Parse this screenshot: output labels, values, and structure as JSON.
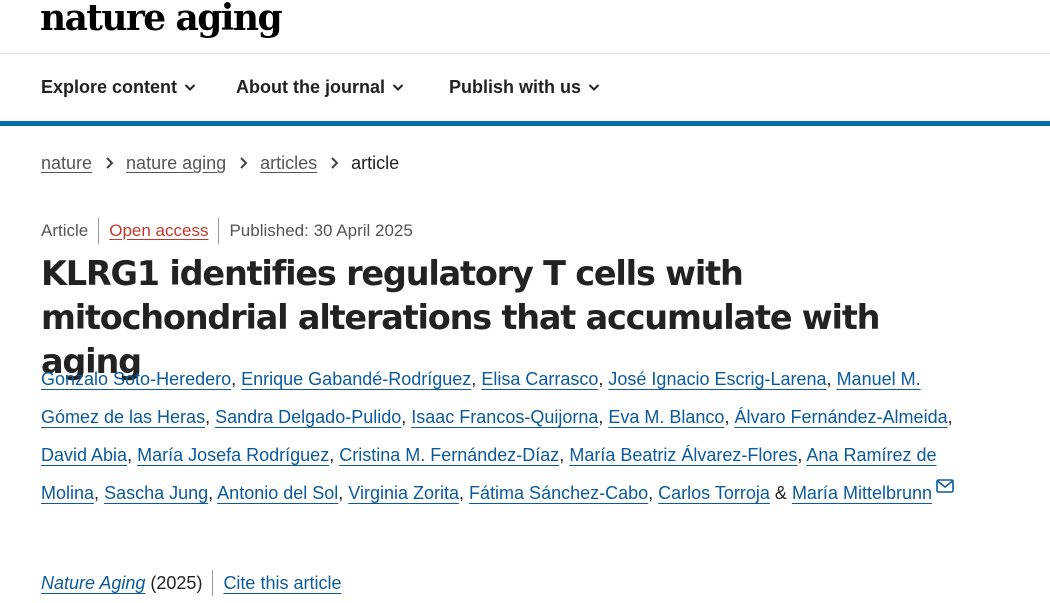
{
  "header": {
    "logo_text": "nature aging"
  },
  "nav": {
    "items": [
      {
        "label": "Explore content"
      },
      {
        "label": "About the journal"
      },
      {
        "label": "Publish with us"
      }
    ]
  },
  "colors": {
    "accent_bar": "#0070a8",
    "link": "#0a5a9c",
    "open_access": "#c0392b"
  },
  "breadcrumb": {
    "items": [
      "nature",
      "nature aging",
      "articles"
    ],
    "current": "article"
  },
  "article": {
    "type": "Article",
    "access": "Open access",
    "published": "Published: 30 April 2025",
    "title": "KLRG1 identifies regulatory T cells with mitochondrial alterations that accumulate with aging",
    "authors": [
      "Gonzalo Soto-Heredero",
      "Enrique Gabandé-Rodríguez",
      "Elisa Carrasco",
      "José Ignacio Escrig-Larena",
      "Manuel M. Gómez de las Heras",
      "Sandra Delgado-Pulido",
      "Isaac Francos-Quijorna",
      "Eva M. Blanco",
      "Álvaro Fernández-Almeida",
      "David Abia",
      "María Josefa Rodríguez",
      "Cristina M. Fernández-Díaz",
      "María Beatriz Álvarez-Flores",
      "Ana Ramírez de Molina",
      "Sascha Jung",
      "Antonio del Sol",
      "Virginia Zorita",
      "Fátima Sánchez-Cabo",
      "Carlos Torroja",
      "María Mittelbrunn"
    ],
    "author_separator": ",",
    "author_conjunction": "&",
    "corresponding_icon": "envelope-icon"
  },
  "citation": {
    "journal": "Nature Aging",
    "year": "(2025)",
    "cite_label": "Cite this article"
  }
}
